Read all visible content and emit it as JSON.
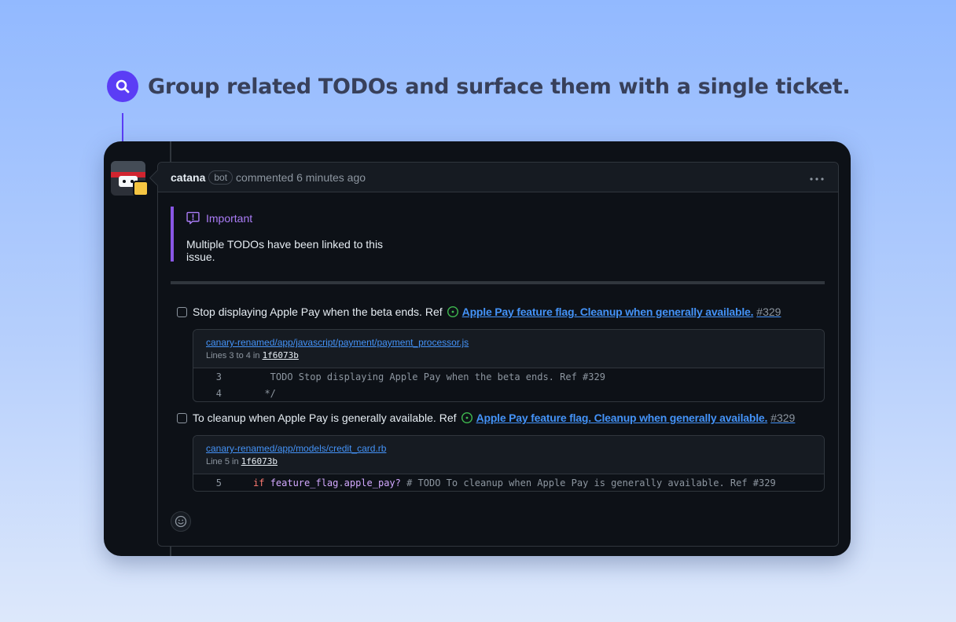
{
  "headline": "Group related TODOs and surface them with a single ticket.",
  "comment": {
    "author": "catana",
    "bot_label": "bot",
    "meta": "commented 6 minutes ago",
    "menu_glyph": "…"
  },
  "callout": {
    "title": "Important",
    "body": "Multiple TODOs have been linked to this issue."
  },
  "tasks": [
    {
      "text": "Stop displaying Apple Pay when the beta ends.",
      "ref_label": "Ref",
      "issue_title": "Apple Pay feature flag. Cleanup when generally available.",
      "issue_number": "#329",
      "file": {
        "path": "canary-renamed/app/javascript/payment/payment_processor.js",
        "lines_prefix": "Lines 3 to 4 in",
        "sha": "1f6073b",
        "code": [
          {
            "num": "3",
            "text": "   TODO Stop displaying Apple Pay when the beta ends. Ref #329"
          },
          {
            "num": "4",
            "text": "  */"
          }
        ]
      }
    },
    {
      "text": "To cleanup when Apple Pay is generally available.",
      "ref_label": "Ref",
      "issue_title": "Apple Pay feature flag. Cleanup when generally available.",
      "issue_number": "#329",
      "file": {
        "path": "canary-renamed/app/models/credit_card.rb",
        "lines_prefix": "Line 5 in",
        "sha": "1f6073b",
        "code": [
          {
            "num": "5",
            "keyword": "if",
            "method": "feature_flag",
            "dot": ".",
            "method2": "apple_pay?",
            "rest": " # TODO To cleanup when Apple Pay is generally available. Ref #329"
          }
        ]
      }
    }
  ],
  "colors": {
    "accent": "#5b3df5",
    "callout": "#8957e5",
    "link": "#4493f8",
    "issue_open": "#3fb950"
  },
  "icons": [
    "search-icon",
    "report-icon",
    "issue-opened-icon",
    "smiley-icon",
    "kebab-icon"
  ]
}
